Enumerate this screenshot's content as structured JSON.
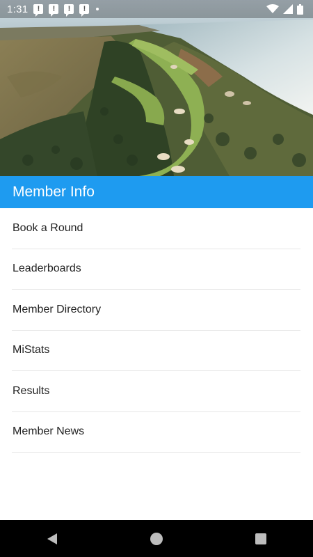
{
  "status_bar": {
    "time": "1:31",
    "notifications": [
      "alert-icon",
      "alert-icon",
      "alert-icon",
      "alert-icon"
    ],
    "right_icons": [
      "wifi-icon",
      "cell-signal-icon",
      "battery-icon"
    ]
  },
  "hero": {
    "image": "aerial-golf-course-photo"
  },
  "header": {
    "title": "Member Info",
    "color": "#1e9bf0"
  },
  "menu": {
    "items": [
      {
        "label": "Book a Round"
      },
      {
        "label": "Leaderboards"
      },
      {
        "label": "Member Directory"
      },
      {
        "label": "MiStats"
      },
      {
        "label": "Results"
      },
      {
        "label": "Member News"
      }
    ]
  },
  "nav_bar": {
    "buttons": [
      "back-icon",
      "home-icon",
      "recents-icon"
    ]
  }
}
